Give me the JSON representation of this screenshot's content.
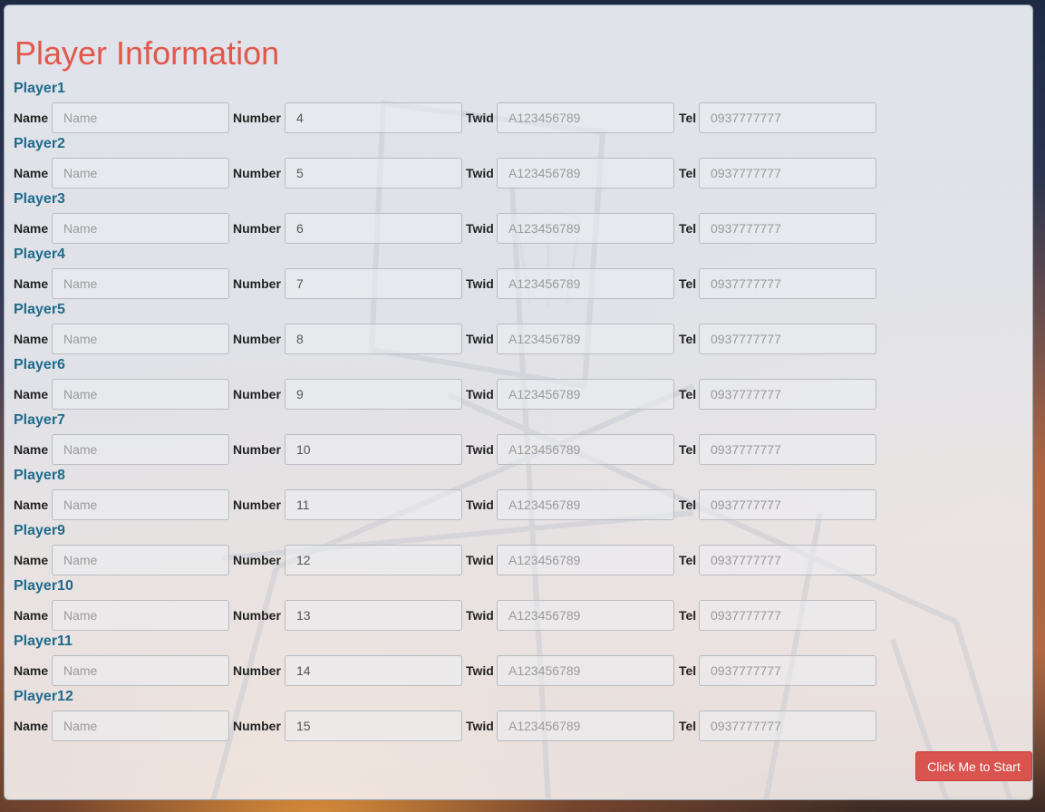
{
  "page": {
    "title": "Player Information",
    "accent_color": "#e2574c",
    "label_color": "#1f6a8a"
  },
  "field_labels": {
    "name": "Name",
    "number": "Number",
    "twid": "Twid",
    "tel": "Tel"
  },
  "players": [
    {
      "label": "Player1",
      "name_placeholder": "Name",
      "number": "4",
      "twid_placeholder": "A123456789",
      "tel_placeholder": "0937777777"
    },
    {
      "label": "Player2",
      "name_placeholder": "Name",
      "number": "5",
      "twid_placeholder": "A123456789",
      "tel_placeholder": "0937777777"
    },
    {
      "label": "Player3",
      "name_placeholder": "Name",
      "number": "6",
      "twid_placeholder": "A123456789",
      "tel_placeholder": "0937777777"
    },
    {
      "label": "Player4",
      "name_placeholder": "Name",
      "number": "7",
      "twid_placeholder": "A123456789",
      "tel_placeholder": "0937777777"
    },
    {
      "label": "Player5",
      "name_placeholder": "Name",
      "number": "8",
      "twid_placeholder": "A123456789",
      "tel_placeholder": "0937777777"
    },
    {
      "label": "Player6",
      "name_placeholder": "Name",
      "number": "9",
      "twid_placeholder": "A123456789",
      "tel_placeholder": "0937777777"
    },
    {
      "label": "Player7",
      "name_placeholder": "Name",
      "number": "10",
      "twid_placeholder": "A123456789",
      "tel_placeholder": "0937777777"
    },
    {
      "label": "Player8",
      "name_placeholder": "Name",
      "number": "11",
      "twid_placeholder": "A123456789",
      "tel_placeholder": "0937777777"
    },
    {
      "label": "Player9",
      "name_placeholder": "Name",
      "number": "12",
      "twid_placeholder": "A123456789",
      "tel_placeholder": "0937777777"
    },
    {
      "label": "Player10",
      "name_placeholder": "Name",
      "number": "13",
      "twid_placeholder": "A123456789",
      "tel_placeholder": "0937777777"
    },
    {
      "label": "Player11",
      "name_placeholder": "Name",
      "number": "14",
      "twid_placeholder": "A123456789",
      "tel_placeholder": "0937777777"
    },
    {
      "label": "Player12",
      "name_placeholder": "Name",
      "number": "15",
      "twid_placeholder": "A123456789",
      "tel_placeholder": "0937777777"
    }
  ],
  "start_button": {
    "label": "Click Me to Start",
    "color": "#d9534f"
  }
}
